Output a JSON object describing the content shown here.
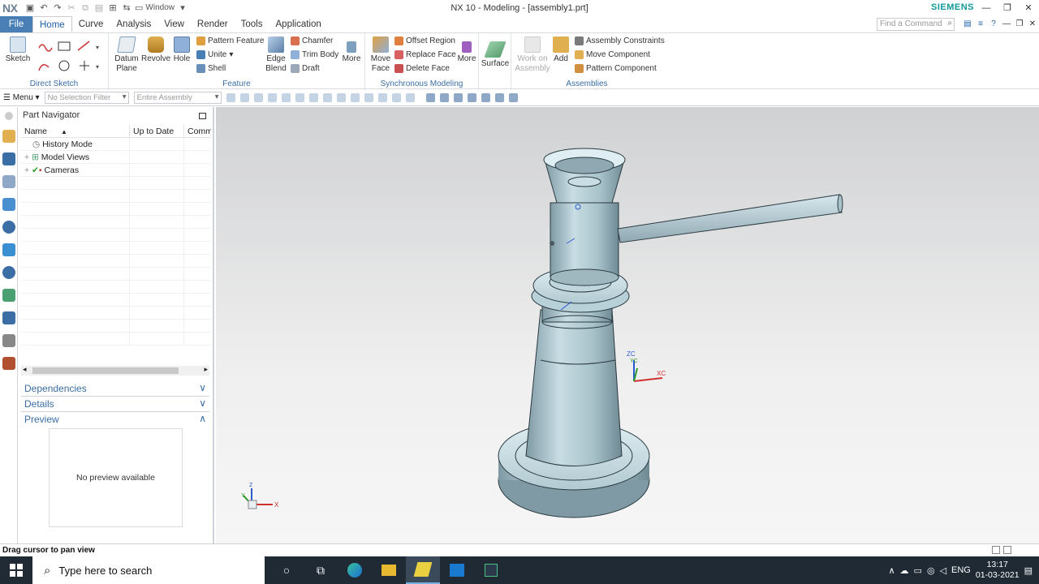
{
  "app": {
    "logo": "NX",
    "window_title": "NX 10 - Modeling - [assembly1.prt]",
    "brand": "SIEMENS",
    "window_menu_label": "Window"
  },
  "menu_tabs": [
    "File",
    "Home",
    "Curve",
    "Analysis",
    "View",
    "Render",
    "Tools",
    "Application"
  ],
  "active_tab": "Home",
  "find_command_placeholder": "Find a Command",
  "ribbon": {
    "direct_sketch": {
      "sketch": "Sketch",
      "label": "Direct Sketch"
    },
    "feature": {
      "datum_plane": "Datum Plane",
      "revolve": "Revolve",
      "hole": "Hole",
      "pattern_feature": "Pattern Feature",
      "unite": "Unite",
      "shell": "Shell",
      "edge_blend": "Edge Blend",
      "chamfer": "Chamfer",
      "trim_body": "Trim Body",
      "draft": "Draft",
      "more": "More",
      "label": "Feature"
    },
    "sync": {
      "move_face": "Move Face",
      "offset_region": "Offset Region",
      "replace_face": "Replace Face",
      "delete_face": "Delete Face",
      "more": "More",
      "label": "Synchronous Modeling"
    },
    "surface": {
      "surface": "Surface"
    },
    "assemblies": {
      "work_on_assembly": "Work on Assembly",
      "add": "Add",
      "assembly_constraints": "Assembly Constraints",
      "move_component": "Move Component",
      "pattern_component": "Pattern Component",
      "label": "Assemblies"
    }
  },
  "toolbar2": {
    "menu": "Menu",
    "selection_filter": "No Selection Filter",
    "scope": "Entire Assembly"
  },
  "navigator": {
    "title": "Part Navigator",
    "columns": [
      "Name",
      "Up to Date",
      "Comm"
    ],
    "rows": [
      {
        "name": "History Mode"
      },
      {
        "name": "Model Views"
      },
      {
        "name": "Cameras"
      }
    ],
    "panels": {
      "dependencies": "Dependencies",
      "details": "Details",
      "preview": "Preview"
    },
    "preview_text": "No preview available"
  },
  "viewport": {
    "wcs_labels": {
      "zc": "ZC",
      "yc": "YC",
      "xc": "XC"
    },
    "triad_labels": {
      "z": "Z",
      "y": "Y",
      "x": "X"
    }
  },
  "status": "Drag cursor to pan view",
  "taskbar": {
    "search_placeholder": "Type here to search",
    "lang": "ENG",
    "time": "13:17",
    "date": "01-03-2021"
  }
}
